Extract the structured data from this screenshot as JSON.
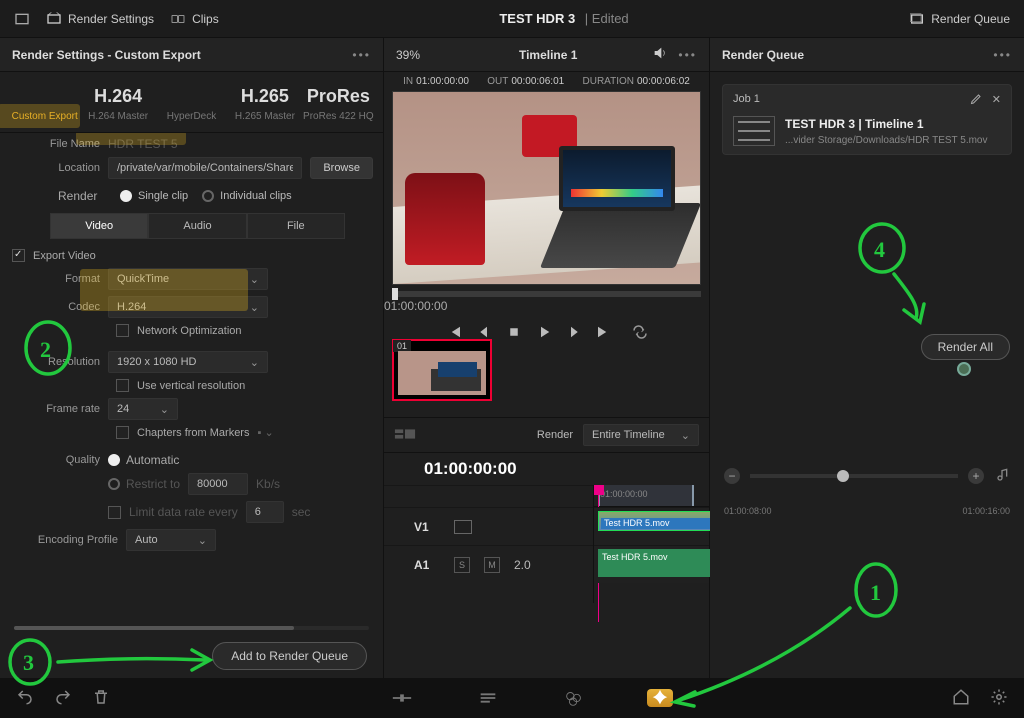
{
  "topbar": {
    "render_settings": "Render Settings",
    "clips": "Clips",
    "project_title": "TEST HDR 3",
    "edited_tag": "Edited",
    "render_queue": "Render Queue"
  },
  "left": {
    "title": "Render Settings - Custom Export",
    "presets": [
      {
        "big": "",
        "sub": "Custom Export",
        "selected": true
      },
      {
        "big": "H.264",
        "sub": "H.264 Master"
      },
      {
        "big": "",
        "sub": "HyperDeck"
      },
      {
        "big": "H.265",
        "sub": "H.265 Master"
      },
      {
        "big": "ProRes",
        "sub": "ProRes 422 HQ"
      }
    ],
    "filename_label": "File Name",
    "filename_value": "HDR TEST 5",
    "location_label": "Location",
    "location_value": "/private/var/mobile/Containers/Shared/AppG",
    "browse": "Browse",
    "render_label": "Render",
    "render_single": "Single clip",
    "render_individual": "Individual clips",
    "tabs": {
      "video": "Video",
      "audio": "Audio",
      "file": "File"
    },
    "export_video": "Export Video",
    "format_label": "Format",
    "format_value": "QuickTime",
    "codec_label": "Codec",
    "codec_value": "H.264",
    "net_opt": "Network Optimization",
    "res_label": "Resolution",
    "res_value": "1920 x 1080 HD",
    "use_vert": "Use vertical resolution",
    "fr_label": "Frame rate",
    "fr_value": "24",
    "chapters": "Chapters from Markers",
    "quality_label": "Quality",
    "quality_auto": "Automatic",
    "restrict": "Restrict to",
    "restrict_val": "80000",
    "restrict_unit": "Kb/s",
    "limit": "Limit data rate every",
    "limit_val": "6",
    "limit_unit": "sec",
    "enc_label": "Encoding Profile",
    "enc_value": "Auto",
    "add_queue": "Add to Render Queue"
  },
  "mid": {
    "zoom_pct": "39%",
    "timeline_name": "Timeline 1",
    "tc_in_label": "IN",
    "tc_in": "01:00:00:00",
    "tc_out_label": "OUT",
    "tc_out": "00:00:06:01",
    "tc_dur_label": "DURATION",
    "tc_dur": "00:00:06:02",
    "play_tc": "01:00:00:00",
    "clip_badge": "01",
    "render_label": "Render",
    "render_scope": "Entire Timeline",
    "tl_tc": "01:00:00:00",
    "ruler_t0": "01:00:00:00",
    "track_v": "V1",
    "track_a": "A1",
    "a_num": "2.0",
    "clip_name": "Test HDR 5.mov",
    "sm_s": "S",
    "sm_m": "M"
  },
  "right": {
    "title": "Render Queue",
    "job_label": "Job 1",
    "job_title": "TEST HDR 3 | Timeline 1",
    "job_path": "...vider Storage/Downloads/HDR TEST 5.mov",
    "render_all": "Render All",
    "ruler_t1": "01:00:08:00",
    "ruler_t2": "01:00:16:00"
  }
}
